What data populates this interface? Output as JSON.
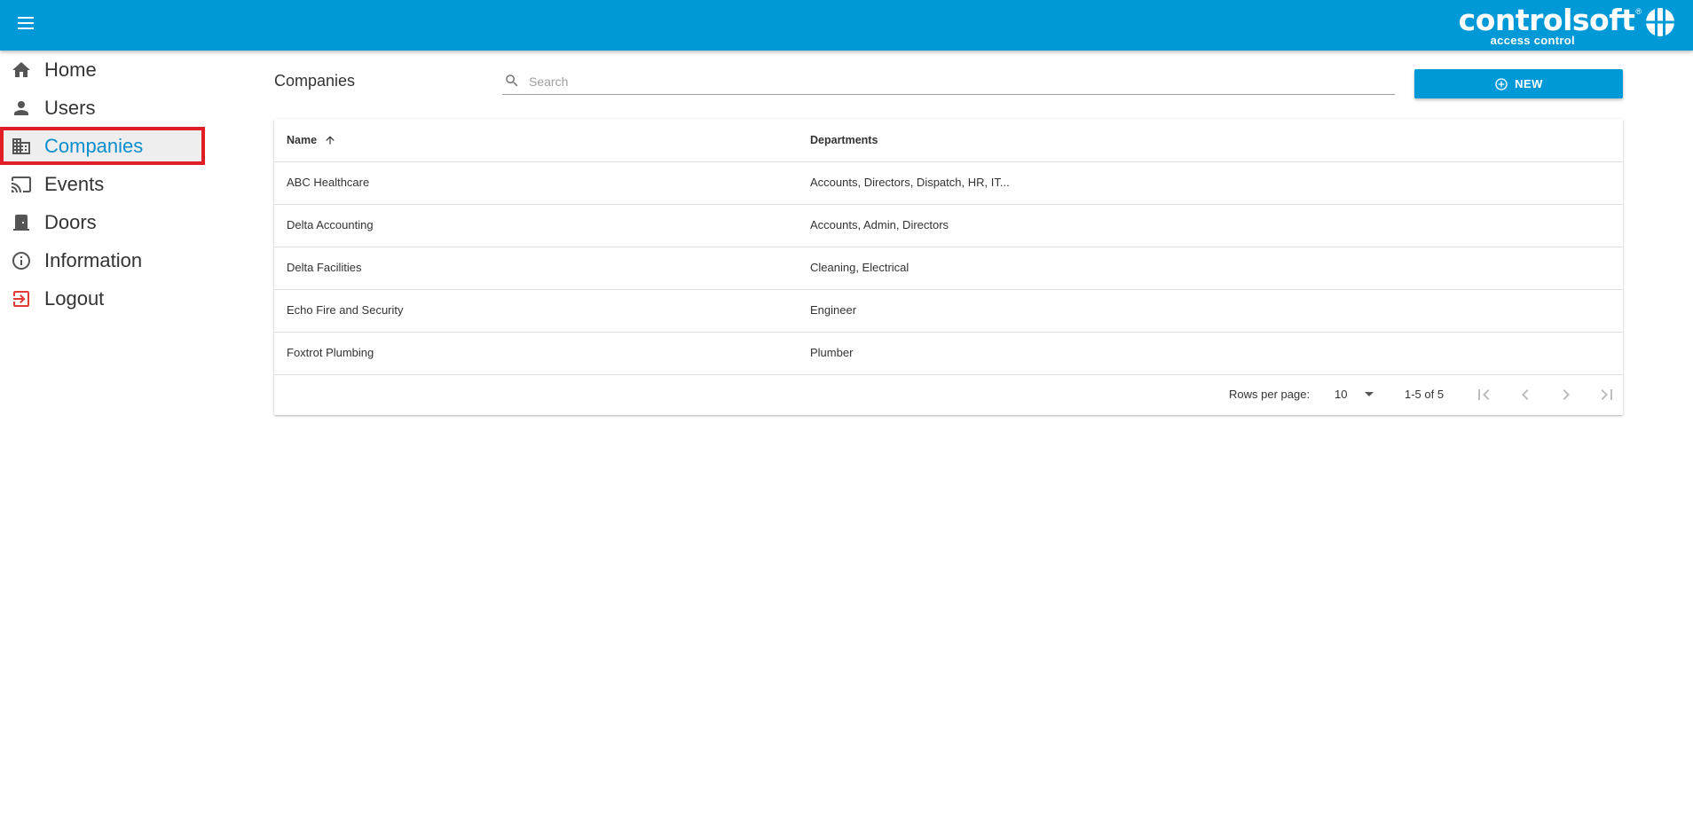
{
  "header": {
    "brand_name": "controlsoft",
    "brand_tagline": "access control",
    "brand_reg": "®",
    "menu_icon": "hamburger-menu-icon",
    "accent": "#0099d8"
  },
  "sidebar": {
    "items": [
      {
        "label": "Home",
        "icon": "home-icon"
      },
      {
        "label": "Users",
        "icon": "person-icon"
      },
      {
        "label": "Companies",
        "icon": "building-icon",
        "active": true
      },
      {
        "label": "Events",
        "icon": "cast-icon"
      },
      {
        "label": "Doors",
        "icon": "door-icon"
      },
      {
        "label": "Information",
        "icon": "info-icon"
      },
      {
        "label": "Logout",
        "icon": "logout-icon"
      }
    ],
    "active_color": "#0a8fce",
    "highlight_border": "#e01e26"
  },
  "main": {
    "title": "Companies",
    "search": {
      "placeholder": "Search",
      "value": ""
    },
    "new_button": {
      "label": "NEW",
      "icon": "add-circle-icon"
    }
  },
  "table": {
    "columns": [
      "Name",
      "Departments"
    ],
    "sort_column": "Name",
    "sort_direction": "ascending",
    "rows": [
      [
        "ABC Healthcare",
        "Accounts, Directors, Dispatch, HR, IT..."
      ],
      [
        "Delta Accounting",
        "Accounts, Admin, Directors"
      ],
      [
        "Delta Facilities",
        "Cleaning, Electrical"
      ],
      [
        "Echo Fire and Security",
        "Engineer"
      ],
      [
        "Foxtrot Plumbing",
        "Plumber"
      ]
    ]
  },
  "pagination": {
    "rows_per_page_label": "Rows per page:",
    "rows_per_page": "10",
    "range": "1-5 of 5"
  }
}
